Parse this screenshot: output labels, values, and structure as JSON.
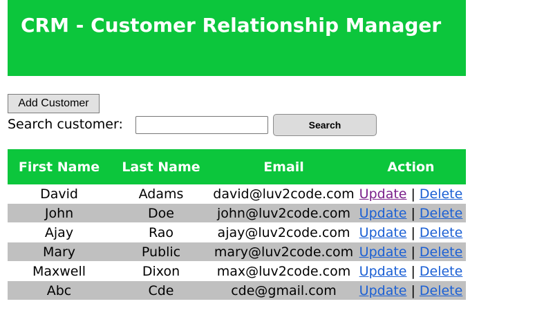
{
  "header": {
    "title": "CRM - Customer Relationship Manager"
  },
  "toolbar": {
    "add_label": "Add Customer",
    "search_label": "Search customer:",
    "search_value": "",
    "search_button_label": "Search"
  },
  "table": {
    "columns": [
      "First Name",
      "Last Name",
      "Email",
      "Action"
    ],
    "rows": [
      {
        "first": "David",
        "last": "Adams",
        "email": "david@luv2code.com",
        "update": "Update",
        "sep": "|",
        "delete": "Delete"
      },
      {
        "first": "John",
        "last": "Doe",
        "email": "john@luv2code.com",
        "update": "Update",
        "sep": "|",
        "delete": "Delete"
      },
      {
        "first": "Ajay",
        "last": "Rao",
        "email": "ajay@luv2code.com",
        "update": "Update",
        "sep": "|",
        "delete": "Delete"
      },
      {
        "first": "Mary",
        "last": "Public",
        "email": "mary@luv2code.com",
        "update": "Update",
        "sep": "|",
        "delete": "Delete"
      },
      {
        "first": "Maxwell",
        "last": "Dixon",
        "email": "max@luv2code.com",
        "update": "Update",
        "sep": "|",
        "delete": "Delete"
      },
      {
        "first": "Abc",
        "last": "Cde",
        "email": "cde@gmail.com",
        "update": "Update",
        "sep": "|",
        "delete": "Delete"
      }
    ]
  },
  "colors": {
    "header_green": "#0cc63c",
    "row_alt": "#c0c0c0",
    "link": "#1a5fd4",
    "link_visited": "#7a1f8a"
  }
}
